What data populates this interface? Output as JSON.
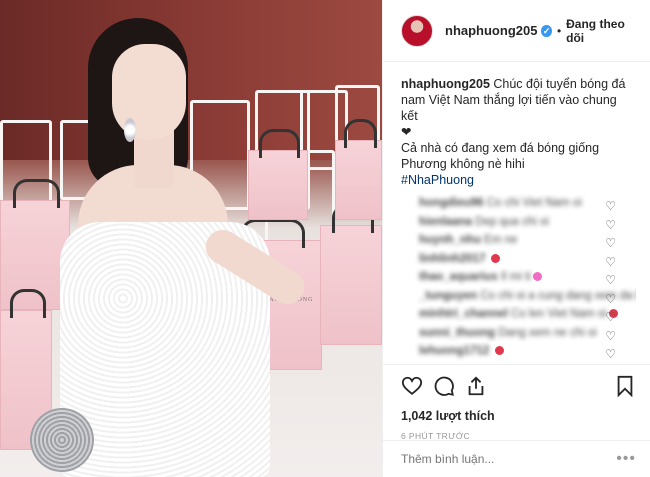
{
  "photo": {
    "bag_brand": "CHUNG THANH PHONG"
  },
  "header": {
    "username": "nhaphuong205",
    "separator": "•",
    "follow_status": "Đang theo dõi",
    "verified_mark": "✓"
  },
  "caption": {
    "username": "nhaphuong205",
    "text_line1": " Chúc đội tuyển bóng đá nam Việt Nam thắng lợi tiến vào chung kết",
    "heart_emoji": "❤",
    "text_line2": "Cả nhà có đang xem đá bóng giống Phương không nè hihi",
    "hashtag": "#NhaPhuong"
  },
  "comments": [
    {
      "user": "hongdieu96",
      "text": "Co chi Viet Nam oi"
    },
    {
      "user": "hienlaana",
      "text": "Dep qua chi oi"
    },
    {
      "user": "huynh_nhu",
      "text": "Em ne"
    },
    {
      "user": "linhlinh2017",
      "text": "",
      "emoji_color": "#e0384d"
    },
    {
      "user": "thao_aquarius",
      "text": "Il mi ti",
      "emoji_color": "#f26bc7"
    },
    {
      "user": "_tunguyen",
      "text": "Co chi oi a cung dang xem da bong",
      "emoji_color": "#f2b531"
    },
    {
      "user": "minhtri_channel",
      "text": "Co len Viet Nam oi",
      "emoji_color": "#e0384d"
    },
    {
      "user": "sunni_thuong",
      "text": "Dang xem ne chi oi"
    },
    {
      "user": "lehuong1712",
      "text": "",
      "emoji_color": "#e0384d"
    }
  ],
  "actions": {
    "likes": "1,042 lượt thích",
    "timestamp": "6 PHÚT TRƯỚC"
  },
  "comment_box": {
    "placeholder": "Thêm bình luận...",
    "more": "•••"
  }
}
